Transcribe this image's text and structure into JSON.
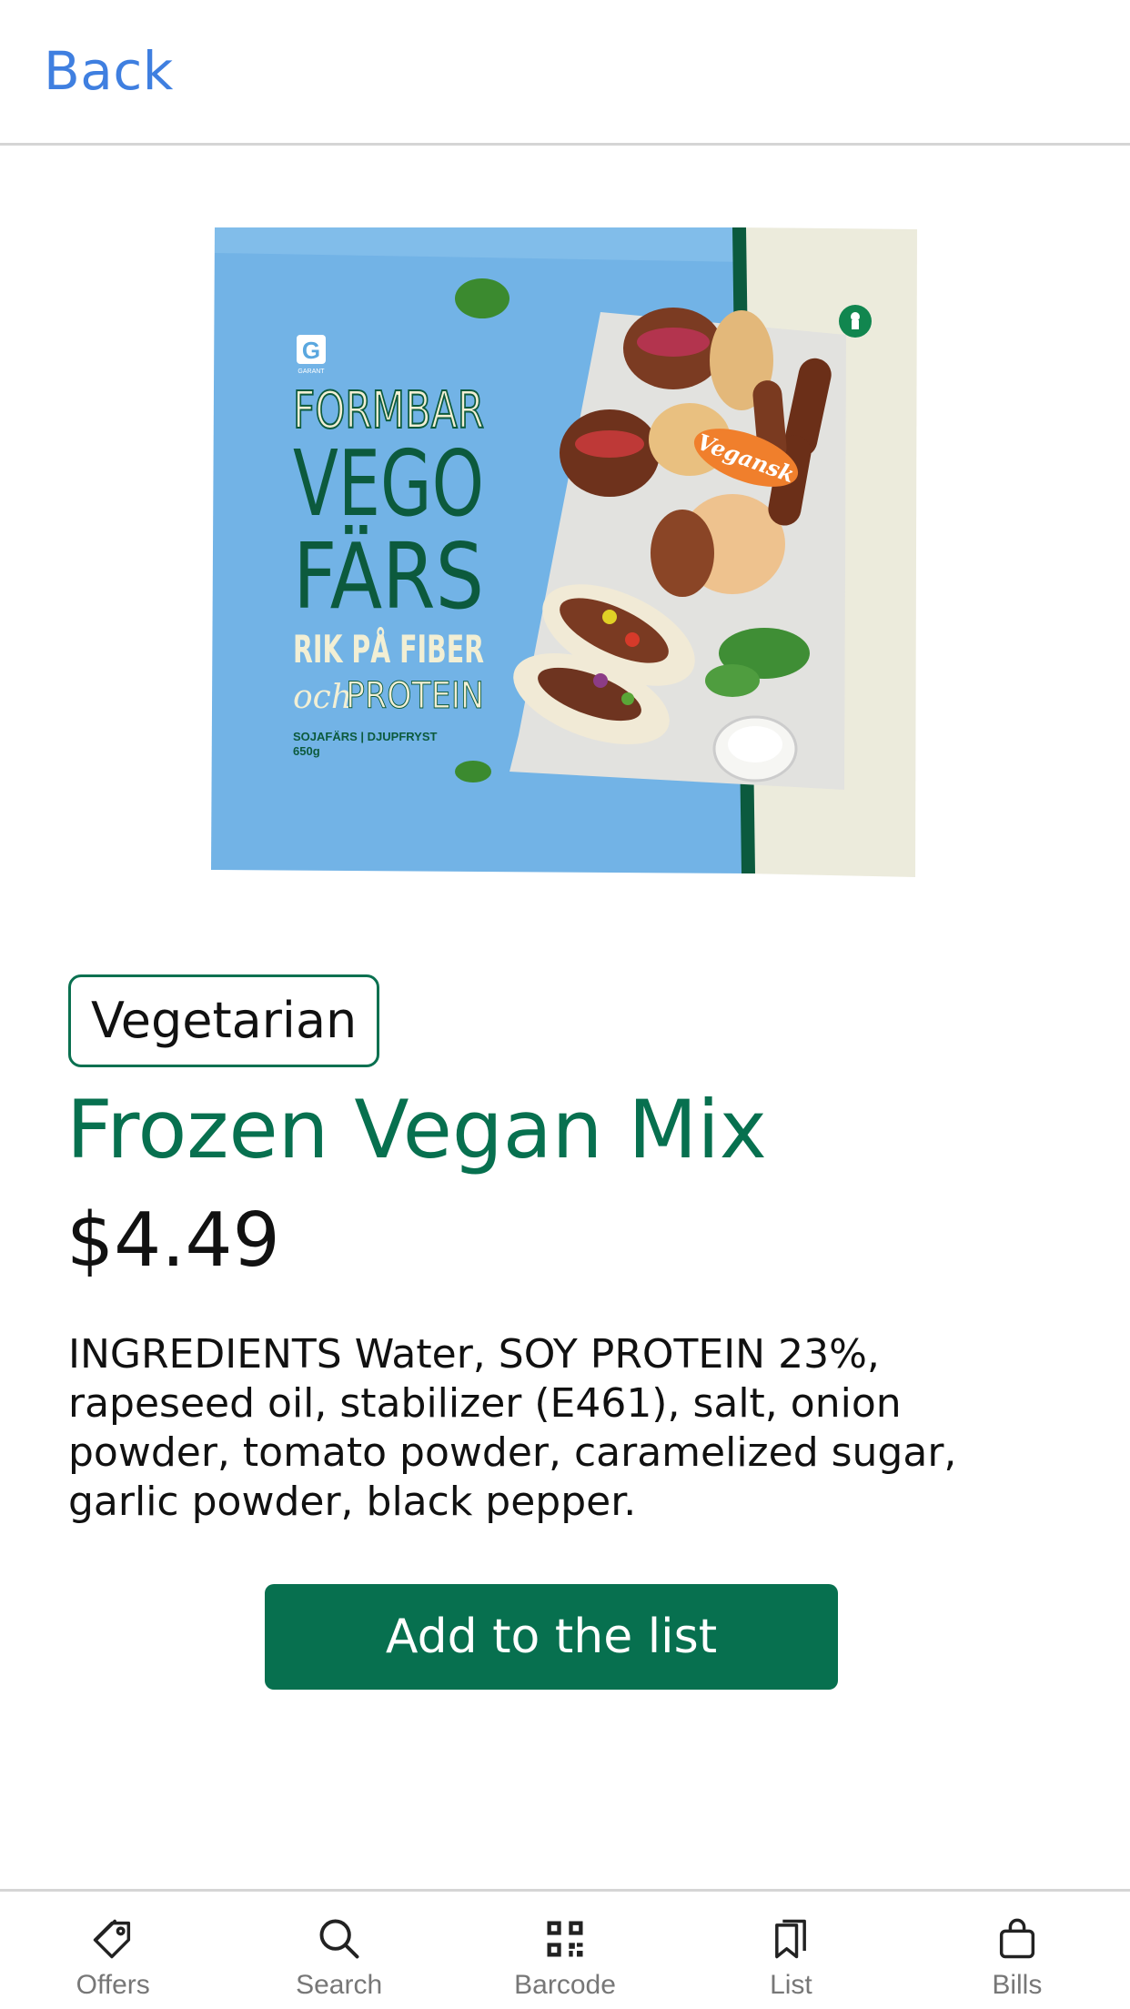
{
  "header": {
    "back_label": "Back"
  },
  "product": {
    "badge": "Vegetarian",
    "name": "Frozen Vegan Mix",
    "price": "$4.49",
    "ingredients": "INGREDIENTS Water, SOY PROTEIN 23%, rapeseed oil, stabilizer (E461), salt, onion powder, tomato powder, caramelized sugar, garlic powder, black pepper.",
    "add_button_label": "Add to the list",
    "image": {
      "brand_mark": "G",
      "brand_sub": "GARANT",
      "line1": "FORMBAR",
      "line2": "VEGO",
      "line3": "FÄRS",
      "line4": "RIK PÅ FIBER",
      "line5_script": "och",
      "line5_rest": "PROTEIN",
      "small1": "SOJAFÄRS | DJUPFRYST",
      "small2": "650g",
      "tag": "Vegansk"
    }
  },
  "tabs": [
    {
      "label": "Offers",
      "icon": "tag-icon"
    },
    {
      "label": "Search",
      "icon": "search-icon"
    },
    {
      "label": "Barcode",
      "icon": "qr-code-icon"
    },
    {
      "label": "List",
      "icon": "bookmarks-icon"
    },
    {
      "label": "Bills",
      "icon": "shopping-bag-icon"
    }
  ],
  "colors": {
    "accent_green": "#07704f",
    "link_blue": "#3f7fe0",
    "package_blue": "#6fb1e3"
  }
}
